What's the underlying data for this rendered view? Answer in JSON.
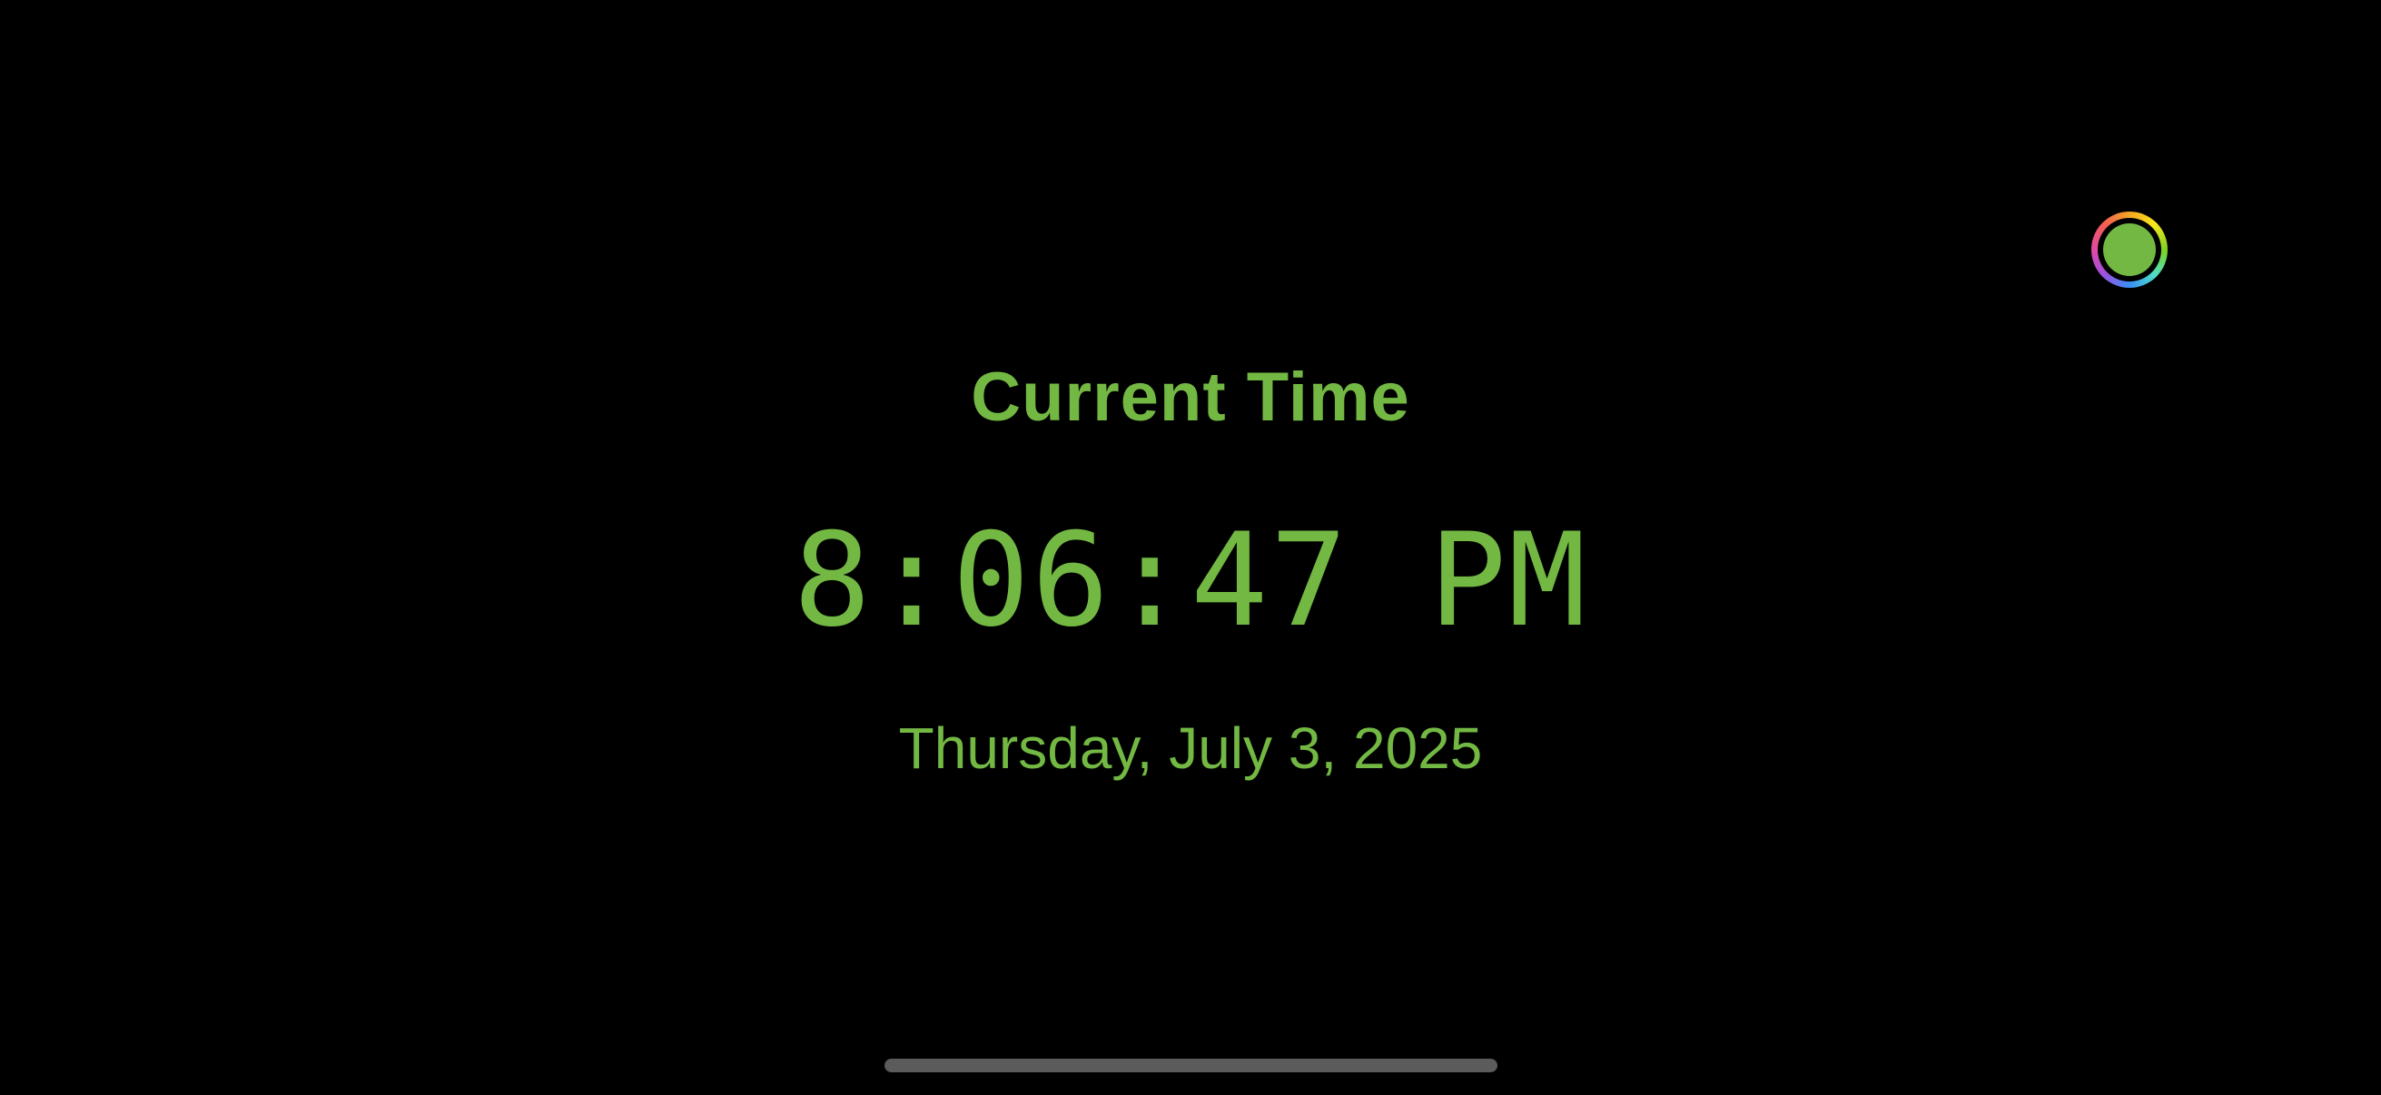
{
  "clock": {
    "title": "Current Time",
    "time": "8:06:47 PM",
    "date": "Thursday, July 3, 2025"
  },
  "color_picker": {
    "icon": "color-wheel-icon",
    "selected_color": "#72b843"
  },
  "colors": {
    "background": "#000000",
    "accent": "#72b843",
    "home_indicator": "#5b5b5b"
  }
}
